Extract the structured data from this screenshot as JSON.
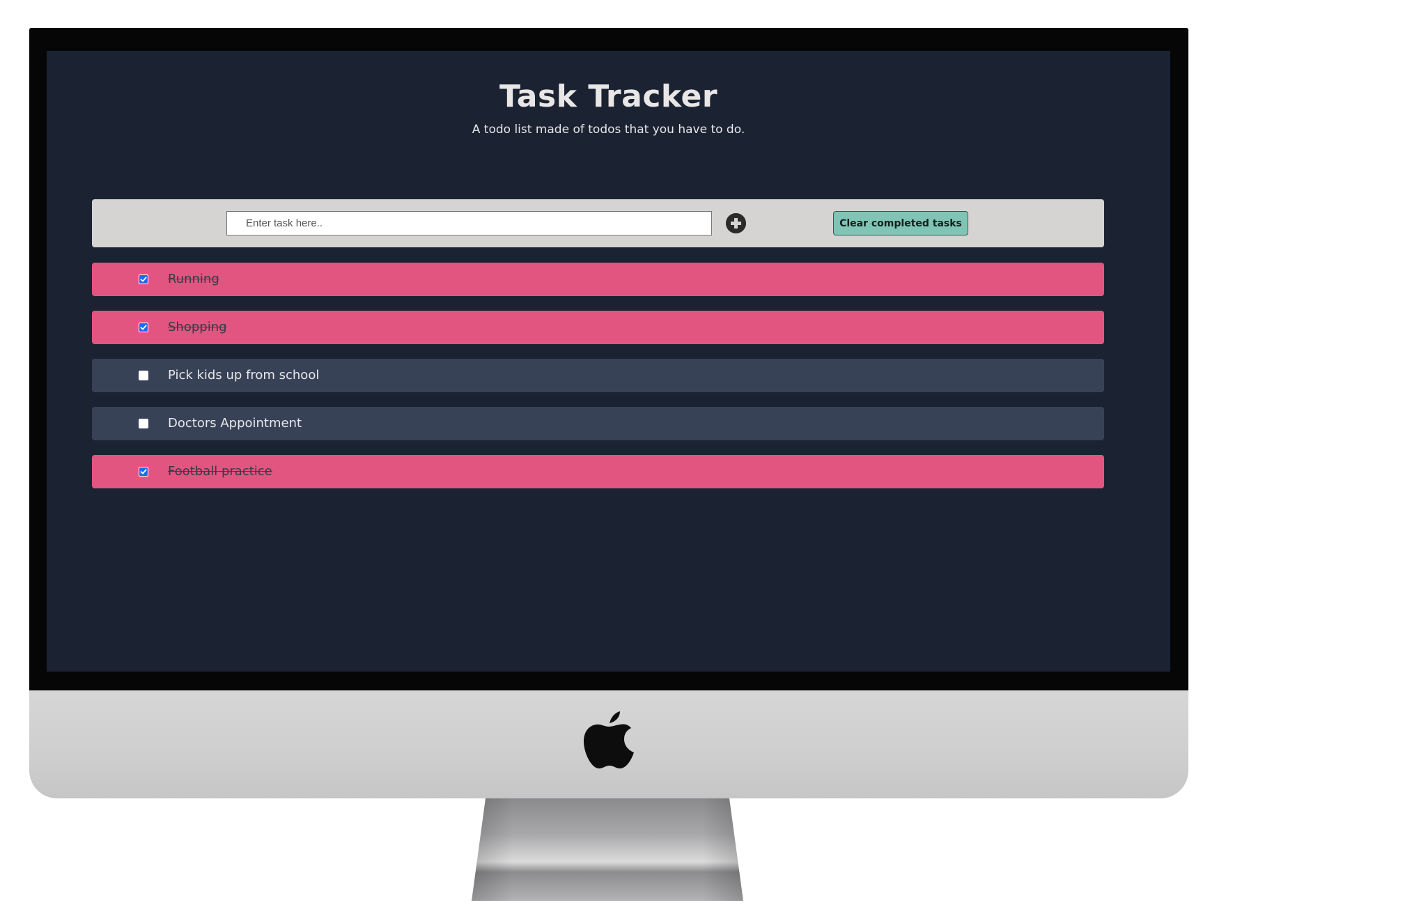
{
  "app": {
    "title": "Task Tracker",
    "subtitle": "A todo list made of todos that you have to do."
  },
  "input_bar": {
    "task_input_value": "",
    "task_input_placeholder": "Enter task here..",
    "add_icon": "plus-circle-icon",
    "clear_label": "Clear completed tasks"
  },
  "tasks": [
    {
      "label": "Running",
      "completed": true
    },
    {
      "label": "Shopping",
      "completed": true
    },
    {
      "label": "Pick kids up from school",
      "completed": false
    },
    {
      "label": "Doctors Appointment",
      "completed": false
    },
    {
      "label": "Football practice",
      "completed": true
    }
  ],
  "colors": {
    "background": "#1b2333",
    "completed_row": "#e25581",
    "pending_row": "#384257",
    "input_bar": "#d5d4d3",
    "clear_button": "#7fc4b4",
    "checkbox_checked": "#1a6de8"
  },
  "device": {
    "logo_icon": "apple-logo-icon"
  }
}
